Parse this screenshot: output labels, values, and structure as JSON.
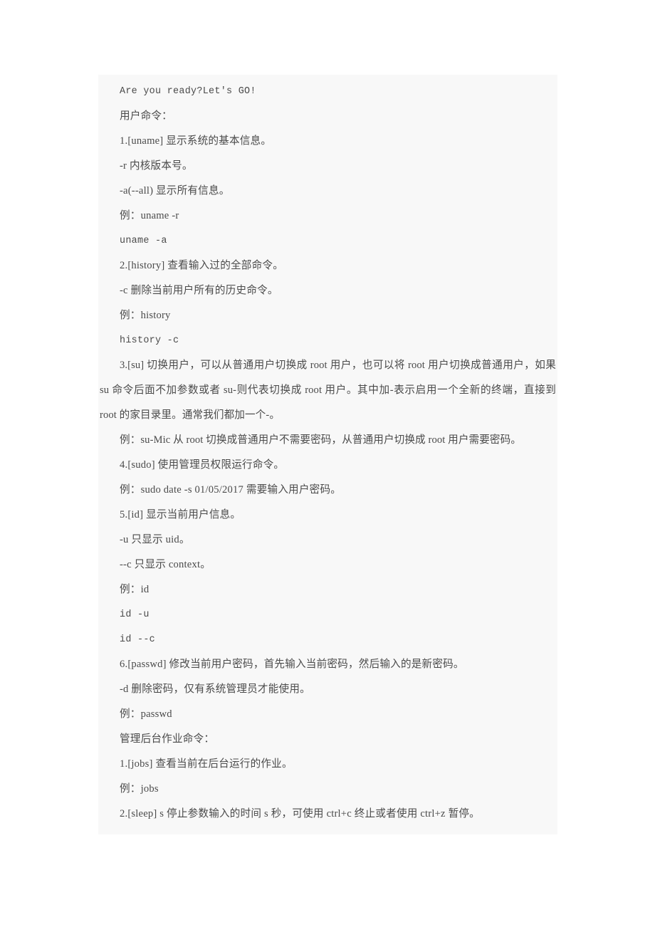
{
  "document": {
    "panel_background": "#f8f8f8",
    "page_background": "#ffffff",
    "text_color": "#4a4a4a",
    "lines": [
      {
        "id": "l01",
        "text": "Are you ready?Let's GO!",
        "style": "mono"
      },
      {
        "id": "l02",
        "text": "用户命令：",
        "style": "section"
      },
      {
        "id": "l03",
        "text": "1.[uname] 显示系统的基本信息。",
        "style": "normal"
      },
      {
        "id": "l04",
        "text": "-r 内核版本号。",
        "style": "normal"
      },
      {
        "id": "l05",
        "text": "-a(--all) 显示所有信息。",
        "style": "normal"
      },
      {
        "id": "l06",
        "text": "例：uname -r",
        "style": "normal"
      },
      {
        "id": "l07",
        "text": "uname -a",
        "style": "mono"
      },
      {
        "id": "l08",
        "text": "2.[history] 查看输入过的全部命令。",
        "style": "normal"
      },
      {
        "id": "l09",
        "text": "-c 删除当前用户所有的历史命令。",
        "style": "normal"
      },
      {
        "id": "l10",
        "text": "例：history",
        "style": "normal"
      },
      {
        "id": "l11",
        "text": "history -c",
        "style": "mono"
      },
      {
        "id": "l12",
        "text": "3.[su] 切换用户，可以从普通用户切换成 root 用户，也可以将 root 用户切换成普通用户，如果 su 命令后面不加参数或者 su-则代表切换成 root 用户。其中加-表示启用一个全新的终端，直接到 root 的家目录里。通常我们都加一个-。",
        "style": "paragraph"
      },
      {
        "id": "l13",
        "text": "例：su-Mic 从 root 切换成普通用户不需要密码，从普通用户切换成 root 用户需要密码。",
        "style": "paragraph"
      },
      {
        "id": "l14",
        "text": "4.[sudo] 使用管理员权限运行命令。",
        "style": "normal"
      },
      {
        "id": "l15",
        "text": "例：sudo date -s 01/05/2017 需要输入用户密码。",
        "style": "normal"
      },
      {
        "id": "l16",
        "text": "5.[id] 显示当前用户信息。",
        "style": "normal"
      },
      {
        "id": "l17",
        "text": "-u 只显示 uid。",
        "style": "normal"
      },
      {
        "id": "l18",
        "text": "--c 只显示 context。",
        "style": "normal"
      },
      {
        "id": "l19",
        "text": "例：id",
        "style": "normal"
      },
      {
        "id": "l20",
        "text": "id -u",
        "style": "mono"
      },
      {
        "id": "l21",
        "text": "id --c",
        "style": "mono"
      },
      {
        "id": "l22",
        "text": "6.[passwd] 修改当前用户密码，首先输入当前密码，然后输入的是新密码。",
        "style": "normal"
      },
      {
        "id": "l23",
        "text": "-d 删除密码，仅有系统管理员才能使用。",
        "style": "normal"
      },
      {
        "id": "l24",
        "text": "例：passwd",
        "style": "normal"
      },
      {
        "id": "l25",
        "text": "管理后台作业命令：",
        "style": "section"
      },
      {
        "id": "l26",
        "text": "1.[jobs] 查看当前在后台运行的作业。",
        "style": "normal"
      },
      {
        "id": "l27",
        "text": "例：jobs",
        "style": "normal"
      },
      {
        "id": "l28",
        "text": "2.[sleep] s 停止参数输入的时间 s 秒，可使用 ctrl+c 终止或者使用 ctrl+z 暂停。",
        "style": "normal"
      }
    ]
  }
}
